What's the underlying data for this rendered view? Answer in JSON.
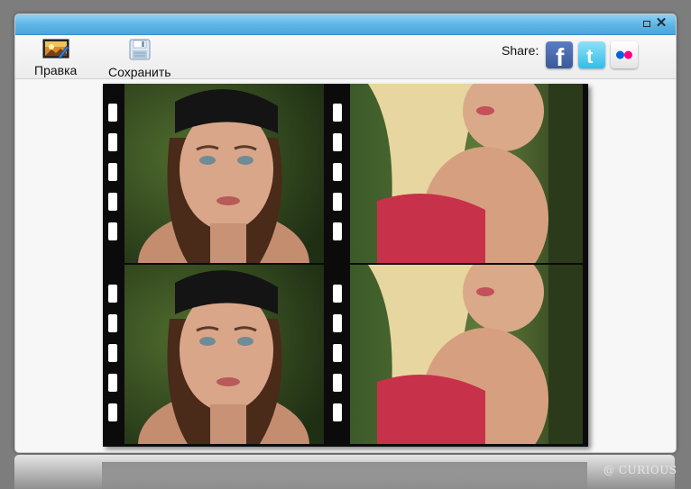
{
  "toolbar": {
    "edit_label": "Правка",
    "save_label": "Сохранить",
    "share_label": "Share:"
  },
  "social": {
    "facebook_glyph": "f",
    "twitter_glyph": "t"
  },
  "icons": {
    "edit": "edit-photo-icon",
    "save": "floppy-disk-icon",
    "maximize": "maximize-icon",
    "close": "close-icon",
    "facebook": "facebook-icon",
    "twitter": "twitter-icon",
    "flickr": "flickr-icon"
  },
  "colors": {
    "titlebar": "#5cb4e6",
    "facebook": "#3b5998",
    "twitter": "#33bde9",
    "flickr_blue": "#0063dc",
    "flickr_pink": "#ff0084"
  },
  "window": {
    "close_glyph": "✕"
  },
  "watermark": "@ CURIOUS"
}
